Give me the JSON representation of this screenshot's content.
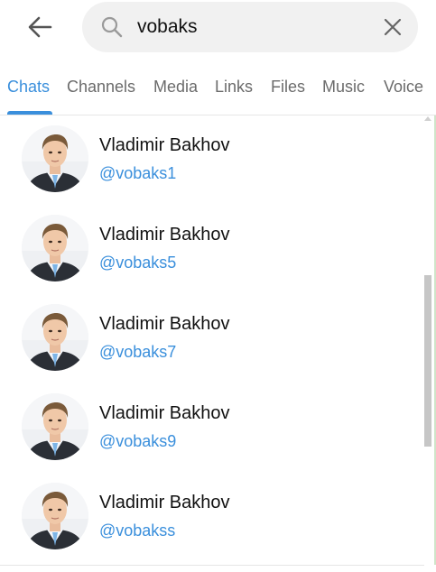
{
  "header": {
    "back_icon": "arrow-left-icon",
    "search": {
      "value": "vobaks",
      "icon": "search-icon",
      "clear_icon": "close-icon"
    }
  },
  "tabs": {
    "items": [
      {
        "label": "Chats",
        "active": true
      },
      {
        "label": "Channels",
        "active": false
      },
      {
        "label": "Media",
        "active": false
      },
      {
        "label": "Links",
        "active": false
      },
      {
        "label": "Files",
        "active": false
      },
      {
        "label": "Music",
        "active": false
      },
      {
        "label": "Voice",
        "active": false
      }
    ]
  },
  "results": [
    {
      "name": "Vladimir Bakhov",
      "username": "@vobaks1"
    },
    {
      "name": "Vladimir Bakhov",
      "username": "@vobaks5"
    },
    {
      "name": "Vladimir Bakhov",
      "username": "@vobaks7"
    },
    {
      "name": "Vladimir Bakhov",
      "username": "@vobaks9"
    },
    {
      "name": "Vladimir Bakhov",
      "username": "@vobakss"
    }
  ],
  "colors": {
    "accent": "#3a8fdc",
    "tab_inactive": "#6b6b6b",
    "search_bg": "#f1f1f1"
  }
}
